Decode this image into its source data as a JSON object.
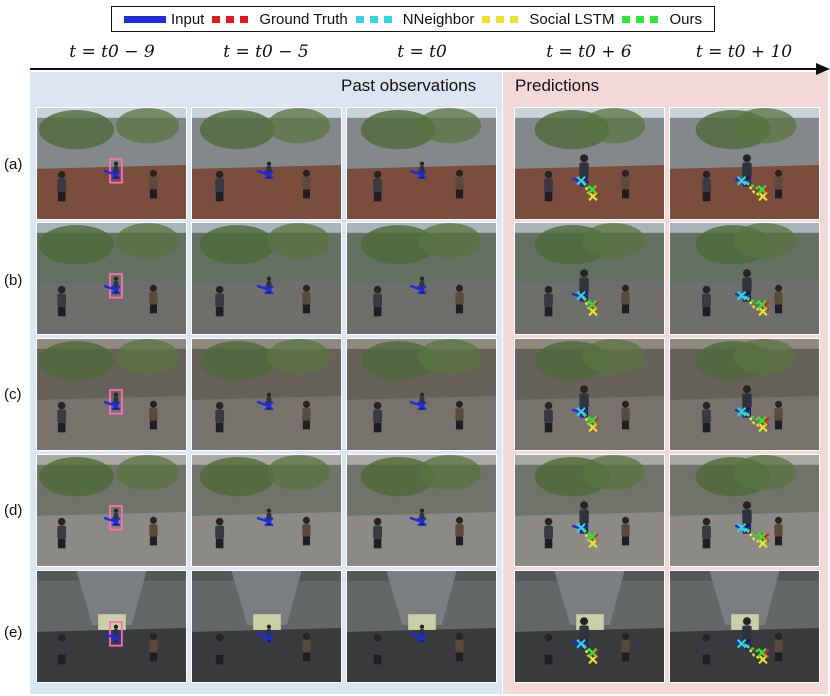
{
  "legend": [
    {
      "label": "Input",
      "color": "#1f2bdf",
      "style": "solid"
    },
    {
      "label": "Ground Truth",
      "color": "#e01a1a",
      "style": "dash"
    },
    {
      "label": "NNeighbor",
      "color": "#2fd6e0",
      "style": "dash"
    },
    {
      "label": "Social LSTM",
      "color": "#f0e030",
      "style": "dash"
    },
    {
      "label": "Ours",
      "color": "#2ee63a",
      "style": "dash"
    }
  ],
  "time_labels": [
    "t = t0 − 9",
    "t = t0 − 5",
    "t = t0",
    "t = t0 + 6",
    "t = t0 + 10"
  ],
  "panels": {
    "past": "Past observations",
    "predictions": "Predictions"
  },
  "rows": [
    "(a)",
    "(b)",
    "(c)",
    "(d)",
    "(e)"
  ],
  "scenes": {
    "a": {
      "sky": "#c9d3da",
      "ground": "#7a4d3c",
      "wall": "#6b6f70"
    },
    "b": {
      "sky": "#a8b4b8",
      "ground": "#6e6e6a",
      "wall": "#4d5a46"
    },
    "c": {
      "sky": "#8f8a80",
      "ground": "#77726c",
      "wall": "#5a544c"
    },
    "d": {
      "sky": "#a9a8a2",
      "ground": "#8b8a84",
      "wall": "#5e6157"
    },
    "e": {
      "sky": "#55575a",
      "ground": "#3a3b3d",
      "wall": "#6a6c6c"
    }
  }
}
